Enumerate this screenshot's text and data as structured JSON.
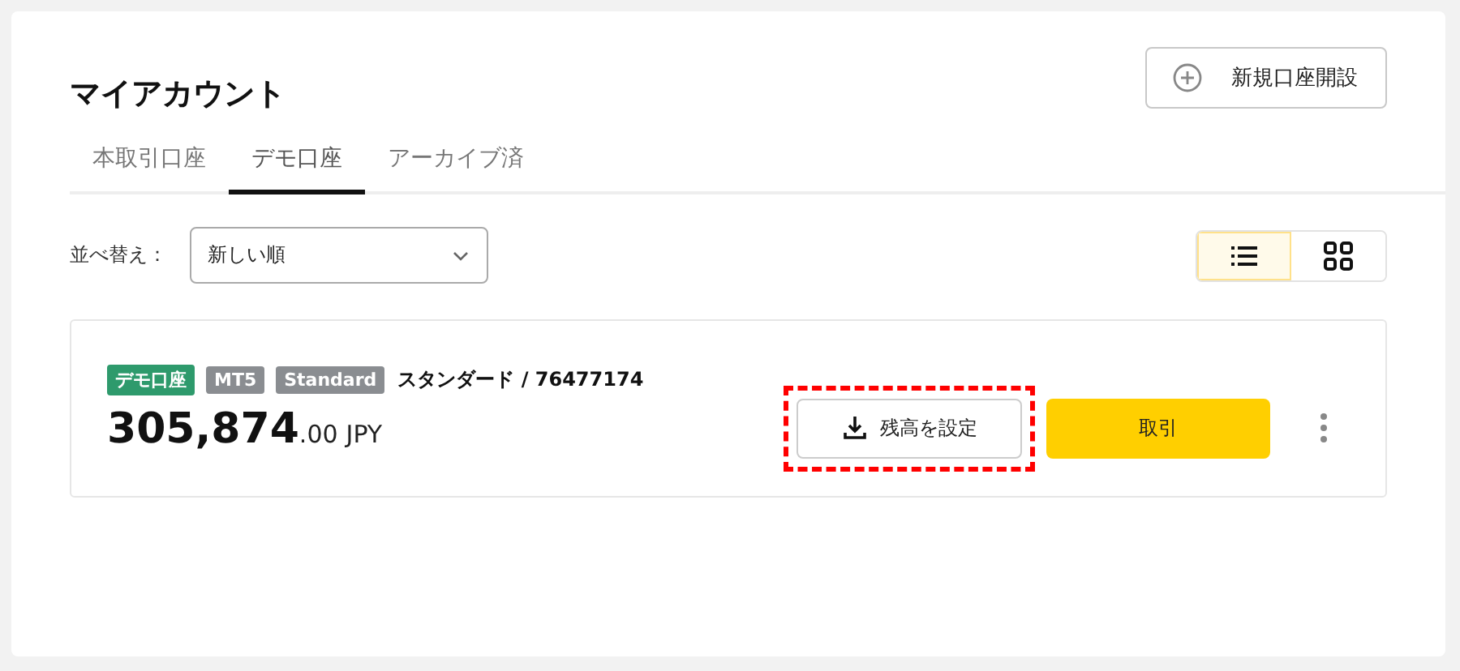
{
  "title": "マイアカウント",
  "new_account_button": {
    "label": "新規口座開設"
  },
  "tabs": [
    {
      "label": "本取引口座",
      "selected": false
    },
    {
      "label": "デモ口座",
      "selected": true
    },
    {
      "label": "アーカイブ済",
      "selected": false
    }
  ],
  "sort": {
    "label": "並べ替え：",
    "value": "新しい順"
  },
  "view_toggle": [
    {
      "kind": "list",
      "selected": true
    },
    {
      "kind": "grid",
      "selected": false
    }
  ],
  "account": {
    "tags": [
      {
        "label": "デモ口座",
        "color": "#2e9a6c"
      },
      {
        "label": "MT5",
        "color": "#8a8d91"
      },
      {
        "label": "Standard",
        "color": "#8a8d91"
      }
    ],
    "name": "スタンダード / 76477174",
    "balance": "305,874",
    "decimals": ".00",
    "currency": "JPY",
    "set_balance_button": {
      "label": "残高を設定",
      "highlighted": true
    },
    "trade_button": {
      "label": "取引"
    }
  }
}
